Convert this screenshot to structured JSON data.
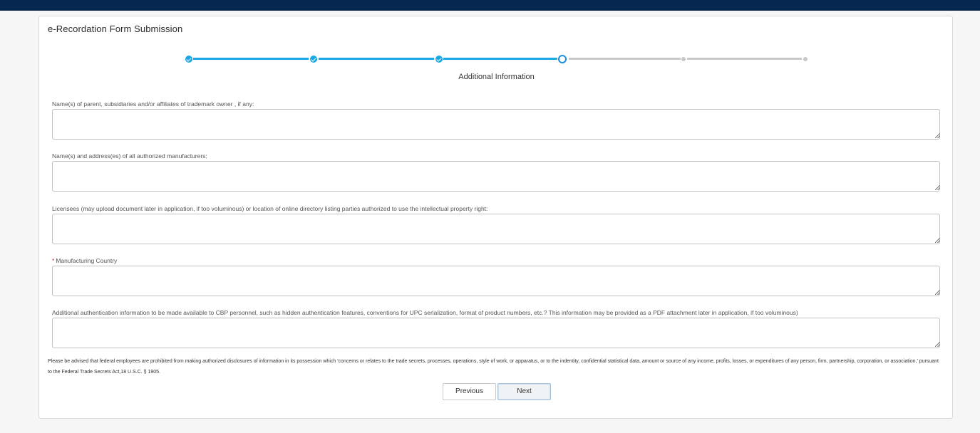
{
  "form": {
    "title": "e-Recordation Form Submission",
    "current_step_label": "Additional Information",
    "steps": [
      "complete",
      "complete",
      "complete",
      "current",
      "incomplete",
      "incomplete"
    ],
    "accent_color": "#1ba8e6"
  },
  "fields": [
    {
      "label": "Name(s) of parent, subsidiaries and/or affiliates of trademark owner , if any:",
      "value": "",
      "required": false
    },
    {
      "label": "Name(s) and address(es) of all authorized manufacturers:",
      "value": "",
      "required": false
    },
    {
      "label": "Licensees (may upload document later in application, if too voluminous) or location of online directory listing parties authorized to use the intellectual property right:",
      "value": "",
      "required": false
    },
    {
      "label": "Manufacturing Country",
      "required_marker": "*",
      "value": "",
      "required": true
    },
    {
      "label": "Additional authentication information to be made available to CBP personnel, such as hidden authentication features, conventions for UPC serialization, format of product numbers, etc.? This information may be provided as a PDF attachment later in application, if too voluminous)",
      "value": "",
      "required": false
    }
  ],
  "disclaimer": "Please be advised that federal employees are prohibited from making authorized disclosures of information in its possession which 'concerns or relates to the trade secrets, processes, operations, style of work, or apparatus, or to the indentity, confidential statistical data, amount or source of any income, profits, losses, or expenditures of any person, firm, partnership, corporation, or association,' pursuant to the Federal Trade Secrets Act,18 U.S.C. § 1905.",
  "buttons": {
    "previous": "Previous",
    "next": "Next"
  }
}
